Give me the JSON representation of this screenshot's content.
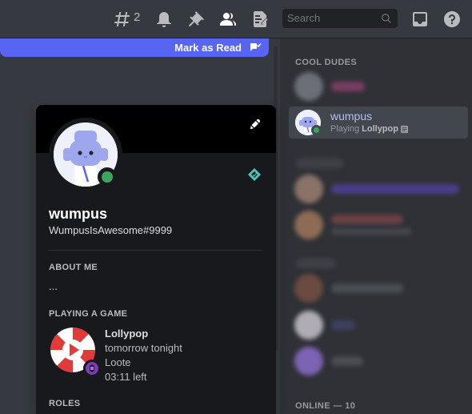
{
  "toolbar": {
    "thread_count": "2",
    "search_placeholder": "Search",
    "icons": [
      "threads-icon",
      "bell-icon",
      "pin-icon",
      "members-icon",
      "notes-icon",
      "search-icon",
      "inbox-icon",
      "help-icon"
    ]
  },
  "chat": {
    "mark_as_read_label": "Mark as Read",
    "accent_color": "#5865f2"
  },
  "members": {
    "sections": [
      {
        "header": "COOL DUDES"
      },
      {
        "header": "ONLINE — 10"
      }
    ],
    "selected_member": {
      "name": "wumpus",
      "activity_prefix": "Playing",
      "activity_name": "Lollypop",
      "status": "online",
      "status_color": "#3ba55d"
    }
  },
  "profile": {
    "username": "wumpus",
    "tag": "WumpusIsAwesome#9999",
    "about_header": "ABOUT ME",
    "about_text": "...",
    "playing_header": "PLAYING A GAME",
    "game": {
      "title": "Lollypop",
      "details": "tomorrow tonight",
      "state": "Loote",
      "time_left": "03:11 left"
    },
    "roles_header": "ROLES"
  }
}
